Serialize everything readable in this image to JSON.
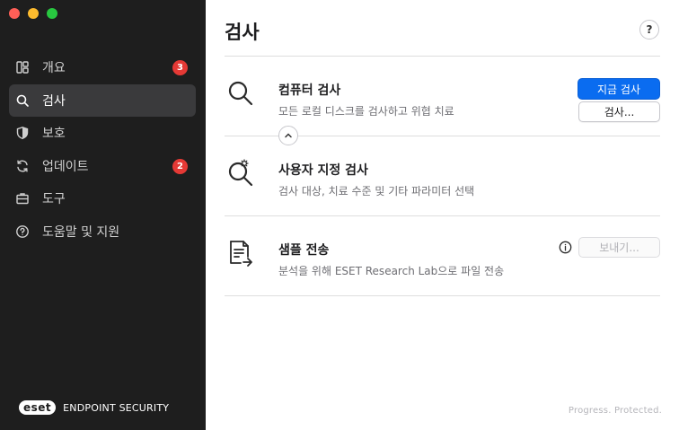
{
  "sidebar": {
    "items": [
      {
        "label": "개요",
        "icon": "dashboard-icon",
        "badge": "3"
      },
      {
        "label": "검사",
        "icon": "search-icon",
        "badge": ""
      },
      {
        "label": "보호",
        "icon": "shield-icon",
        "badge": ""
      },
      {
        "label": "업데이트",
        "icon": "refresh-icon",
        "badge": "2"
      },
      {
        "label": "도구",
        "icon": "briefcase-icon",
        "badge": ""
      },
      {
        "label": "도움말 및 지원",
        "icon": "help-circle-icon",
        "badge": ""
      }
    ],
    "active_index": 1,
    "logo_mark": "eset",
    "logo_text": "ENDPOINT SECURITY"
  },
  "main": {
    "title": "검사",
    "help_label": "?",
    "computer_scan": {
      "title": "컴퓨터 검사",
      "subtitle": "모든 로컬 디스크를 검사하고 위협 치료",
      "button": "지금 검사"
    },
    "custom_scan": {
      "title": "사용자 지정 검사",
      "subtitle": "검사 대상, 치료 수준 및 기타 파라미터 선택",
      "button": "검사..."
    },
    "sample_submission": {
      "title": "샘플 전송",
      "subtitle": "분석을 위해 ESET Research Lab으로 파일 전송",
      "button": "보내기..."
    },
    "footer": "Progress. Protected."
  },
  "colors": {
    "sidebar_bg": "#1e1e1e",
    "active_item_bg": "#3a3a3c",
    "badge": "#e53935",
    "primary_button": "#0a6cf0"
  }
}
